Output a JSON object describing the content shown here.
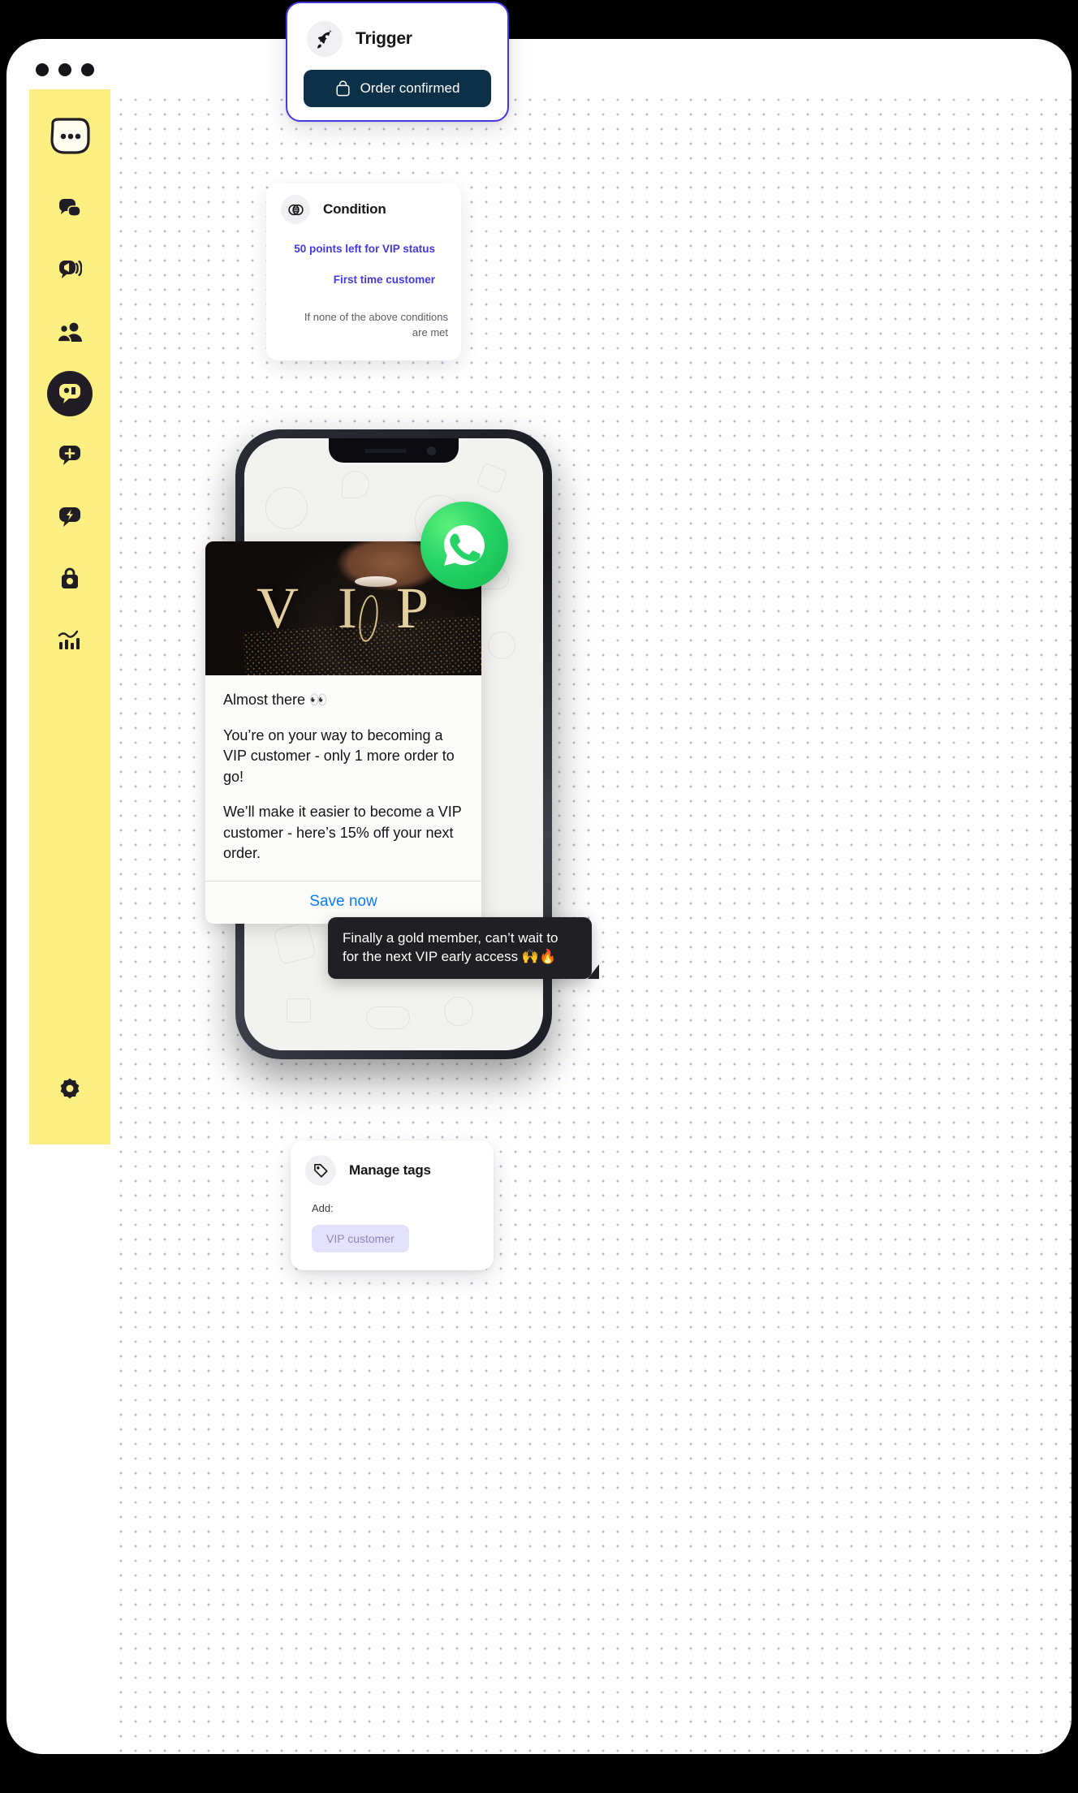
{
  "window": {
    "dots": [
      "close",
      "minimize",
      "maximize"
    ]
  },
  "sidebar": {
    "logo_name": "chat-logo",
    "items": [
      {
        "name": "sidebar-item-inbox",
        "icon": "chat-bubbles-icon",
        "active": false
      },
      {
        "name": "sidebar-item-broadcast",
        "icon": "megaphone-chat-icon",
        "active": false
      },
      {
        "name": "sidebar-item-contacts",
        "icon": "people-icon",
        "active": false
      },
      {
        "name": "sidebar-item-flows",
        "icon": "flow-chat-icon",
        "active": true
      },
      {
        "name": "sidebar-item-add",
        "icon": "plus-bubble-icon",
        "active": false
      },
      {
        "name": "sidebar-item-automation",
        "icon": "lightning-bubble-icon",
        "active": false
      },
      {
        "name": "sidebar-item-commerce",
        "icon": "shopping-bag-icon",
        "active": false
      },
      {
        "name": "sidebar-item-analytics",
        "icon": "bar-chart-icon",
        "active": false
      }
    ],
    "settings": {
      "name": "sidebar-item-settings",
      "icon": "gear-icon"
    }
  },
  "flow": {
    "accent_color": "#4338e8",
    "trigger": {
      "icon": "rocket-icon",
      "title": "Trigger",
      "chip_icon": "shopping-bag-icon",
      "chip_label": "Order confirmed"
    },
    "condition": {
      "icon": "venn-diagram-icon",
      "title": "Condition",
      "branches": [
        "50 points left for VIP status",
        "First time customer"
      ],
      "fallback": "If none of the above conditions are met"
    },
    "tags": {
      "icon": "tag-icon",
      "title": "Manage tags",
      "action_label": "Add:",
      "chip": "VIP customer"
    }
  },
  "phone": {
    "channel_badge": "whatsapp-icon",
    "message": {
      "image_alt": "VIP",
      "image_word": "VIP",
      "headline": "Almost there 👀",
      "paragraphs": [
        "You’re on your way to becoming a VIP customer - only 1 more order to go!",
        "We’ll make it easier to become a VIP customer - here’s 15% off your next order."
      ],
      "cta_label": "Save now",
      "cta_color": "#0a7cff"
    },
    "reply": "Finally a gold member, can’t wait to for the next VIP early access 🙌🔥"
  }
}
